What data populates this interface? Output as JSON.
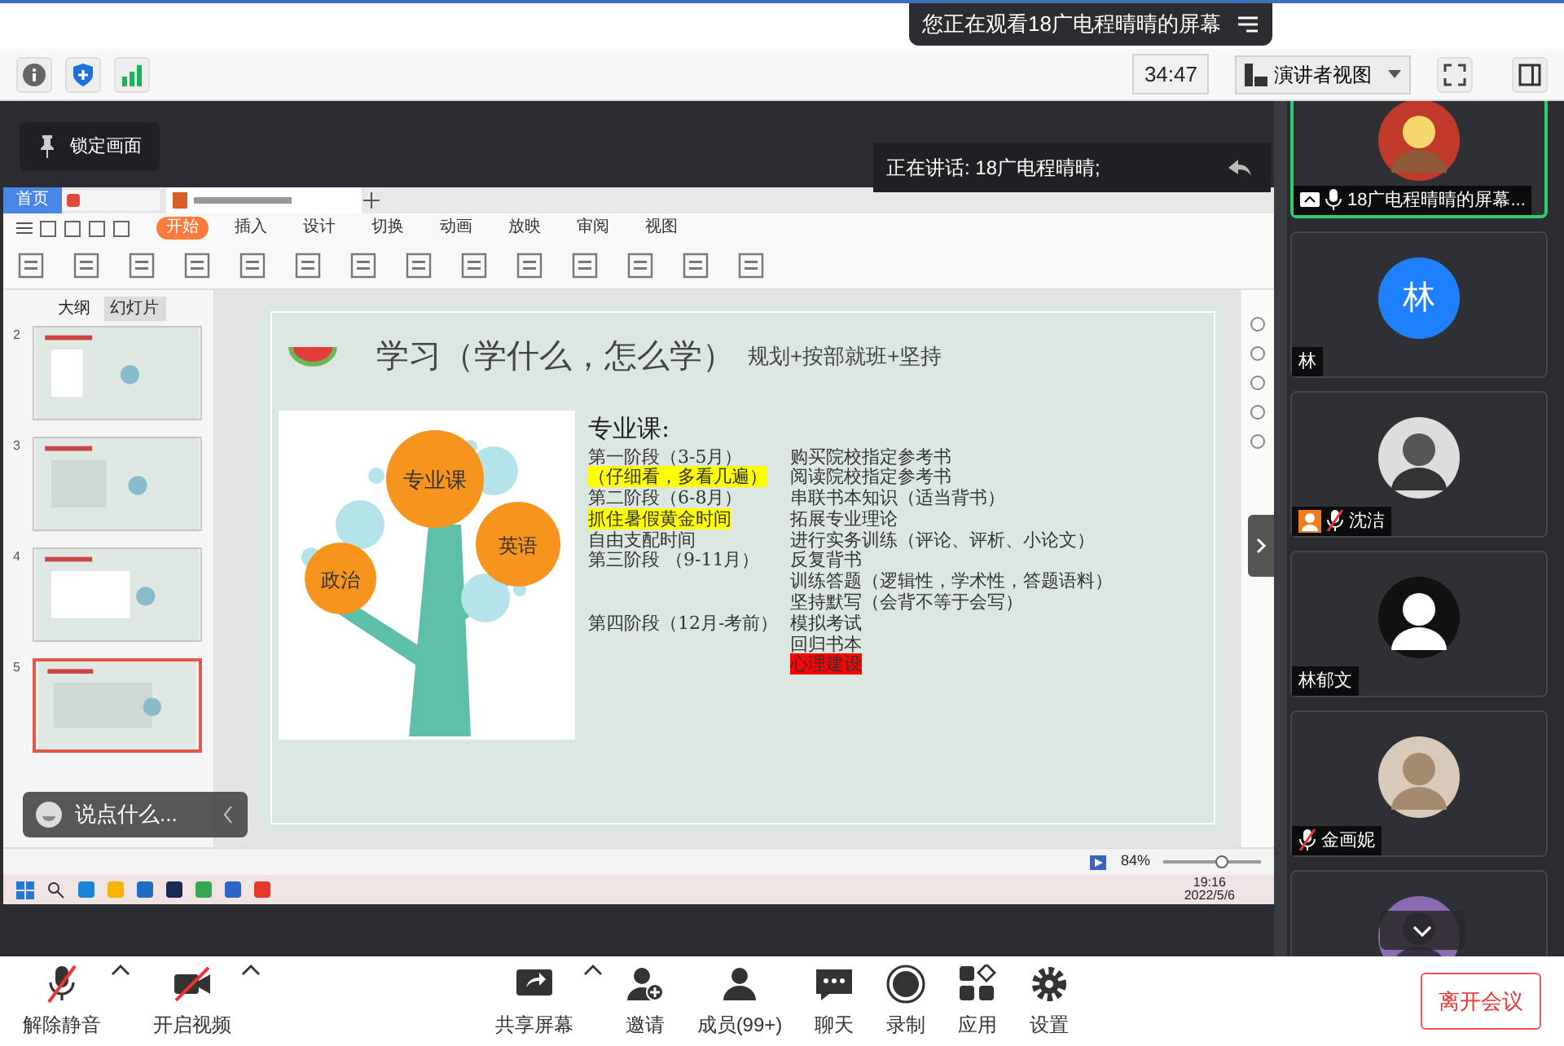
{
  "banner": {
    "text": "您正在观看18广电程晴晴的屏幕"
  },
  "toolbar": {
    "timer": "34:47",
    "view_menu": "演讲者视图"
  },
  "lock_button": "锁定画面",
  "speaking": "正在讲话: 18广电程晴晴;",
  "shared_screen": {
    "app_tabs": [
      {
        "label": "首页",
        "selected": true
      }
    ],
    "ribbon_tabs": [
      {
        "label": "开始",
        "selected": true
      },
      {
        "label": "插入",
        "selected": false
      },
      {
        "label": "设计",
        "selected": false
      },
      {
        "label": "切换",
        "selected": false
      },
      {
        "label": "动画",
        "selected": false
      },
      {
        "label": "放映",
        "selected": false
      },
      {
        "label": "审阅",
        "selected": false
      },
      {
        "label": "视图",
        "selected": false
      }
    ],
    "panel_tabs": [
      {
        "label": "大纲",
        "selected": false
      },
      {
        "label": "幻灯片",
        "selected": true
      }
    ],
    "thumbnails": [
      {
        "number": "2",
        "selected": false
      },
      {
        "number": "3",
        "selected": false
      },
      {
        "number": "4",
        "selected": false
      },
      {
        "number": "5",
        "selected": true
      }
    ],
    "slide": {
      "title": "学习（学什么，怎么学）",
      "subtitle": "规划+按部就班+坚持",
      "tree_labels": [
        "专业课",
        "英语",
        "政治"
      ],
      "heading": "专业课:",
      "rows": [
        {
          "left": {
            "text": "第一阶段（3-5月）"
          },
          "right": {
            "text": "购买院校指定参考书"
          }
        },
        {
          "left": {
            "text": "（仔细看，多看几遍）",
            "color": "#ffff00"
          },
          "right": {
            "text": "阅读院校指定参考书"
          }
        },
        {
          "left": {
            "text": "第二阶段（6-8月）"
          },
          "right": {
            "text": "串联书本知识（适当背书）"
          }
        },
        {
          "left": {
            "text": "抓住暑假黄金时间",
            "color": "#ffff00"
          },
          "right": {
            "text": "拓展专业理论"
          }
        },
        {
          "left": {
            "text": "自由支配时间"
          },
          "right": {
            "text": "进行实务训练（评论、评析、小论文）"
          }
        },
        {
          "left": {
            "text": "第三阶段 （9-11月）"
          },
          "right": {
            "text": "反复背书"
          }
        },
        {
          "right": {
            "text": "训练答题（逻辑性，学术性，答题语料）"
          }
        },
        {
          "right": {
            "text": "坚持默写（会背不等于会写）"
          }
        },
        {
          "left": {
            "text": "第四阶段（12月-考前）"
          },
          "right": {
            "text": "模拟考试"
          }
        },
        {
          "right": {
            "text": "回归书本"
          }
        },
        {
          "right": {
            "text": "心理建设",
            "color": "#ff0000"
          }
        }
      ]
    },
    "zoom": {
      "text": "84%",
      "level": 0.6
    },
    "taskbar": {
      "time": "19:16",
      "date": "2022/5/6"
    }
  },
  "chat_input": {
    "placeholder": "说点什么..."
  },
  "participants": [
    {
      "kind": "picture",
      "name": "18广电程晴晴的屏幕...",
      "screen_share": true,
      "muted": false,
      "selected": true
    },
    {
      "kind": "initial",
      "initial": "林",
      "name": "林",
      "selected": false
    },
    {
      "kind": "picture",
      "name": "沈洁",
      "person_badge": true,
      "muted": true,
      "selected": false
    },
    {
      "kind": "picture",
      "name": "林郁文",
      "selected": false
    },
    {
      "kind": "picture",
      "name": "金画妮",
      "muted": true,
      "selected": false
    },
    {
      "kind": "picture",
      "selected": false
    }
  ],
  "controls": [
    {
      "kind": "mic",
      "label": "解除静音",
      "off": true,
      "menu": true
    },
    {
      "kind": "video",
      "label": "开启视频",
      "off": true,
      "menu": true
    },
    {
      "kind": "share",
      "label": "共享屏幕",
      "menu": true
    },
    {
      "kind": "invite",
      "label": "邀请"
    },
    {
      "kind": "members",
      "label": "成员(99+)"
    },
    {
      "kind": "chat",
      "label": "聊天"
    },
    {
      "kind": "record",
      "label": "录制"
    },
    {
      "kind": "apps",
      "label": "应用"
    },
    {
      "kind": "settings",
      "label": "设置"
    }
  ],
  "leave_button": "离开会议"
}
